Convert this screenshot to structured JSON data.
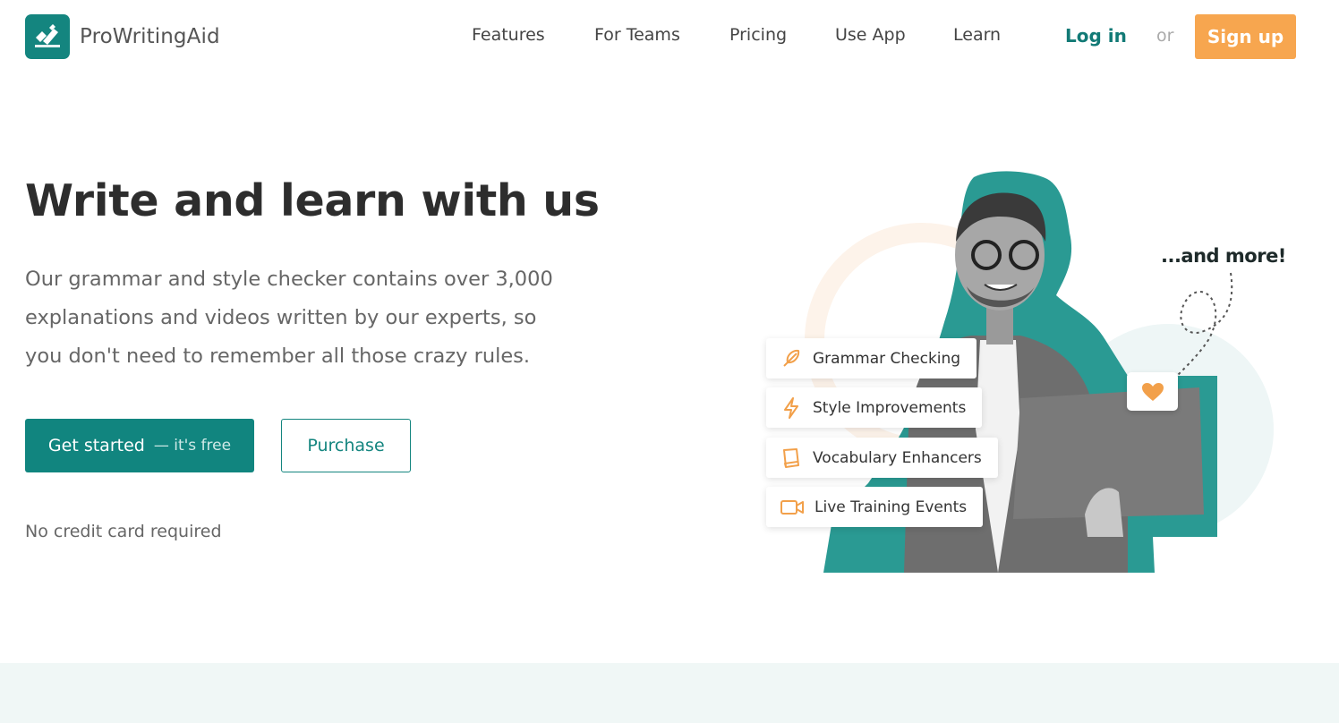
{
  "brand": {
    "name": "ProWritingAid",
    "color": "#14857f"
  },
  "nav": {
    "items": [
      "Features",
      "For Teams",
      "Pricing",
      "Use App",
      "Learn"
    ],
    "login": "Log in",
    "or": "or",
    "signup": "Sign up"
  },
  "hero": {
    "title": "Write and learn with us",
    "subtitle": "Our grammar and style checker contains over 3,000 explanations and videos written by our experts, so you don't need to remember all those crazy rules.",
    "cta_primary": "Get started",
    "cta_primary_note": "— it's free",
    "cta_secondary": "Purchase",
    "note": "No credit card required"
  },
  "illustration": {
    "features": [
      {
        "label": "Grammar Checking",
        "icon": "feather-icon"
      },
      {
        "label": "Style Improvements",
        "icon": "lightning-icon"
      },
      {
        "label": "Vocabulary Enhancers",
        "icon": "book-icon"
      },
      {
        "label": "Live Training Events",
        "icon": "video-camera-icon"
      }
    ],
    "more": "...and more!",
    "heart_icon": "heart-icon"
  },
  "colors": {
    "accent": "#14857f",
    "cta": "#f7a64f",
    "icon_orange": "#f2a04a",
    "band": "#f0f7f6"
  }
}
